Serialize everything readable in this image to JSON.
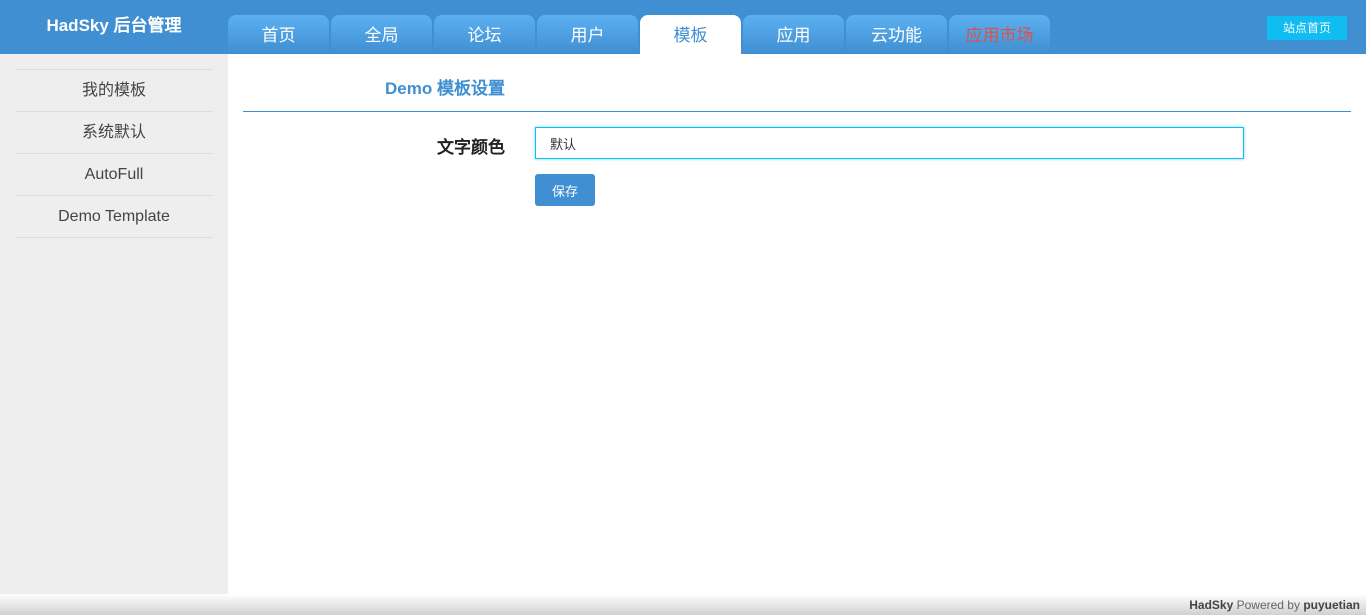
{
  "header": {
    "brand": "HadSky 后台管理",
    "tabs": [
      {
        "label": "首页"
      },
      {
        "label": "全局"
      },
      {
        "label": "论坛"
      },
      {
        "label": "用户"
      },
      {
        "label": "模板",
        "active": true
      },
      {
        "label": "应用"
      },
      {
        "label": "云功能"
      },
      {
        "label": "应用市场"
      }
    ],
    "site_home_label": "站点首页"
  },
  "sidebar": {
    "items": [
      {
        "label": "我的模板"
      },
      {
        "label": "系统默认"
      },
      {
        "label": "AutoFull"
      },
      {
        "label": "Demo Template"
      }
    ]
  },
  "main": {
    "title": "Demo 模板设置",
    "form": {
      "text_color_label": "文字颜色",
      "text_color_value": "默认",
      "save_label": "保存"
    }
  },
  "footer": {
    "brand": "HadSky",
    "powered_by": "Powered by",
    "author": "puyuetian"
  },
  "colors": {
    "accent": "#3f8fd2",
    "site_home_button": "#10bdf2",
    "market_tab_text": "#d9534f",
    "sidebar_bg": "#eeeeee"
  }
}
